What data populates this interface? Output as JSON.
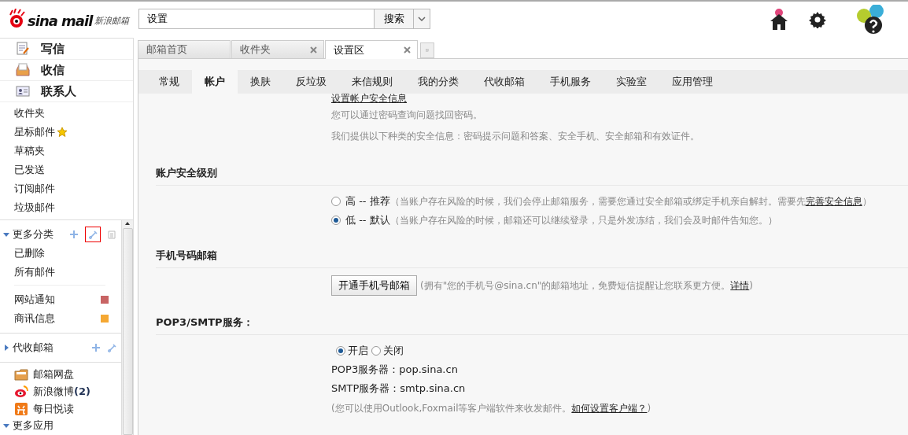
{
  "logo": {
    "brand": "sina mail",
    "subtitle": "新浪邮箱"
  },
  "search": {
    "value": "设置",
    "button": "搜索"
  },
  "sidebar": {
    "actions": [
      {
        "kind": "compose",
        "label": "写信"
      },
      {
        "kind": "inbox",
        "label": "收信"
      },
      {
        "kind": "contacts",
        "label": "联系人"
      }
    ],
    "folders": [
      {
        "label": "收件夹",
        "starred": false
      },
      {
        "label": "星标邮件",
        "starred": true
      },
      {
        "label": "草稿夹",
        "starred": false
      },
      {
        "label": "已发送",
        "starred": false
      },
      {
        "label": "订阅邮件",
        "starred": false
      },
      {
        "label": "垃圾邮件",
        "starred": false
      }
    ],
    "groups": [
      {
        "title": "更多分类",
        "expanded": true,
        "tools": [
          {
            "kind": "add"
          },
          {
            "kind": "edit",
            "highlighted": true
          },
          {
            "kind": "list"
          }
        ],
        "items": [
          {
            "label": "已删除"
          },
          {
            "label": "所有邮件"
          }
        ],
        "tagged": [
          {
            "label": "网站通知",
            "color": "#c86464"
          },
          {
            "label": "商讯信息",
            "color": "#f5a833"
          }
        ]
      },
      {
        "title": "代收邮箱",
        "expanded": false,
        "tools": [
          {
            "kind": "add"
          },
          {
            "kind": "edit"
          }
        ]
      }
    ],
    "apps": [
      {
        "kind": "disk",
        "label": "邮箱网盘"
      },
      {
        "kind": "weibo",
        "label": "新浪微博",
        "count": "(2)"
      },
      {
        "kind": "read",
        "label": "每日悦读"
      }
    ],
    "more": {
      "title": "更多应用",
      "expanded": true
    }
  },
  "tabs": [
    {
      "label": "邮箱首页",
      "closable": false,
      "selected": false
    },
    {
      "label": "收件夹",
      "closable": true,
      "selected": false
    },
    {
      "label": "设置区",
      "closable": true,
      "selected": true
    }
  ],
  "subtabs": [
    {
      "label": "常规",
      "selected": false
    },
    {
      "label": "帐户",
      "selected": true
    },
    {
      "label": "换肤",
      "selected": false
    },
    {
      "label": "反垃圾",
      "selected": false
    },
    {
      "label": "来信规则",
      "selected": false
    },
    {
      "label": "我的分类",
      "selected": false
    },
    {
      "label": "代收邮箱",
      "selected": false
    },
    {
      "label": "手机服务",
      "selected": false
    },
    {
      "label": "实验室",
      "selected": false
    },
    {
      "label": "应用管理",
      "selected": false
    }
  ],
  "security_info": {
    "link": "设置帐户安全信息",
    "notes": [
      "您可以通过密码查询问题找回密码。",
      "我们提供以下种类的安全信息：密码提示问题和答案、安全手机、安全邮箱和有效证件。"
    ]
  },
  "sections": [
    {
      "kind": "radios",
      "title": "账户安全级别",
      "options": [
        {
          "label": "高 -- 推荐",
          "note": "（当账户存在风险的时候，我们会停止邮箱服务，需要您通过安全邮箱或绑定手机亲自解封。需要先",
          "link": "完善安全信息",
          "tail": "）",
          "selected": false
        },
        {
          "label": "低 -- 默认",
          "note": "（当账户存在风险的时候，邮箱还可以继续登录，只是外发冻结，我们会及时邮件告知您。）",
          "selected": true
        }
      ]
    },
    {
      "kind": "button",
      "title": "手机号码邮箱",
      "button": "开通手机号邮箱",
      "note": "(拥有\"您的手机号@sina.cn\"的邮箱地址，免费短信提醒让您联系更方便。",
      "link": "详情",
      "tail": ")"
    },
    {
      "kind": "pop",
      "title": "POP3/SMTP服务：",
      "options": [
        {
          "label": "开启",
          "selected": true
        },
        {
          "label": "关闭",
          "selected": false
        }
      ],
      "servers": [
        "POP3服务器：pop.sina.cn",
        "SMTP服务器：smtp.sina.cn"
      ],
      "note": "(您可以使用Outlook,Foxmail等客户端软件来收发邮件。",
      "link": "如何设置客户端？",
      "tail": ")"
    }
  ]
}
